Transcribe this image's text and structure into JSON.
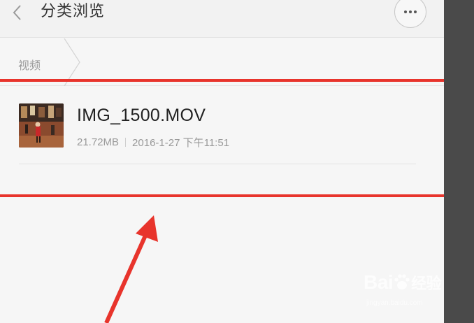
{
  "header": {
    "title": "分类浏览",
    "back_icon": "chevron-left-icon",
    "more_icon": "more-dots-icon"
  },
  "breadcrumb": {
    "items": [
      {
        "label": "视频"
      }
    ]
  },
  "files": [
    {
      "name": "IMG_1500.MOV",
      "size": "21.72MB",
      "date": "2016-1-27 下午11:51"
    }
  ],
  "watermark": {
    "brand_left": "Bai",
    "brand_right": "经验",
    "url": "jingyan.baidu.com"
  },
  "colors": {
    "annotation": "#e8342c",
    "background": "#f6f6f6",
    "text_primary": "#222222",
    "text_secondary": "#999999"
  }
}
